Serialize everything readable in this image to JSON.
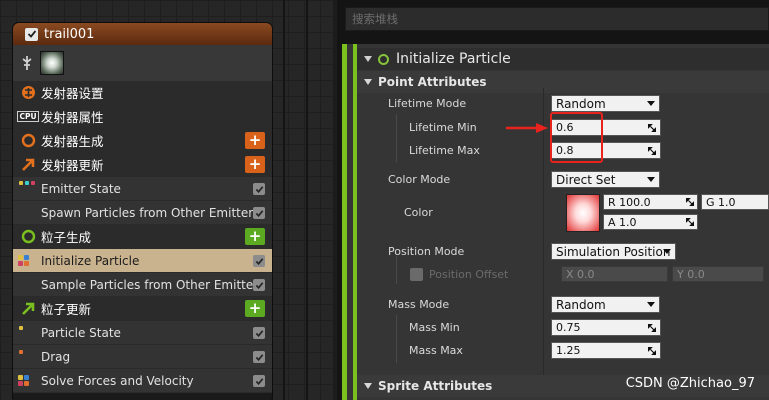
{
  "node": {
    "title": "trail001",
    "rows": [
      {
        "label": "发射器设置",
        "type": "section",
        "icon": "emitter-settings-icon"
      },
      {
        "label": "发射器属性",
        "type": "section",
        "icon": "cpu-icon"
      },
      {
        "label": "发射器生成",
        "type": "section",
        "icon": "emitter-spawn-icon"
      },
      {
        "label": "发射器更新",
        "type": "section",
        "icon": "emitter-update-icon"
      },
      {
        "label": "Emitter State",
        "type": "sub"
      },
      {
        "label": "Spawn Particles from Other Emitter",
        "type": "sub"
      },
      {
        "label": "粒子生成",
        "type": "section",
        "icon": "particle-spawn-icon"
      },
      {
        "label": "Initialize Particle",
        "type": "sub",
        "selected": true
      },
      {
        "label": "Sample Particles from Other Emitter",
        "type": "sub"
      },
      {
        "label": "粒子更新",
        "type": "section",
        "icon": "particle-update-icon"
      },
      {
        "label": "Particle State",
        "type": "sub"
      },
      {
        "label": "Drag",
        "type": "sub"
      },
      {
        "label": "Solve Forces and Velocity",
        "type": "sub"
      }
    ],
    "cpu_text": "CPU"
  },
  "search": {
    "placeholder": "搜索堆栈"
  },
  "details": {
    "title": "Initialize Particle",
    "point_attributes": "Point Attributes",
    "lifetime_mode": {
      "label": "Lifetime Mode",
      "value": "Random"
    },
    "lifetime_min": {
      "label": "Lifetime Min",
      "value": "0.6"
    },
    "lifetime_max": {
      "label": "Lifetime Max",
      "value": "0.8"
    },
    "color_mode": {
      "label": "Color Mode",
      "value": "Direct Set"
    },
    "color": {
      "label": "Color",
      "r": "R 100.0",
      "g": "G 1.0",
      "a": "A 1.0"
    },
    "position_mode": {
      "label": "Position Mode",
      "value": "Simulation Position"
    },
    "position_offset": {
      "label": "Position Offset",
      "x": "X 0.0",
      "y": "Y 0.0"
    },
    "mass_mode": {
      "label": "Mass Mode",
      "value": "Random"
    },
    "mass_min": {
      "label": "Mass Min",
      "value": "0.75"
    },
    "mass_max": {
      "label": "Mass Max",
      "value": "1.25"
    },
    "sprite_attributes": "Sprite Attributes"
  },
  "watermark": "CSDN @Zhichao_97",
  "colors": {
    "accent_green": "#7ac01f",
    "selected_row": "#c9b28e",
    "highlight_red": "#e8231d",
    "orange": "#d8621a"
  }
}
